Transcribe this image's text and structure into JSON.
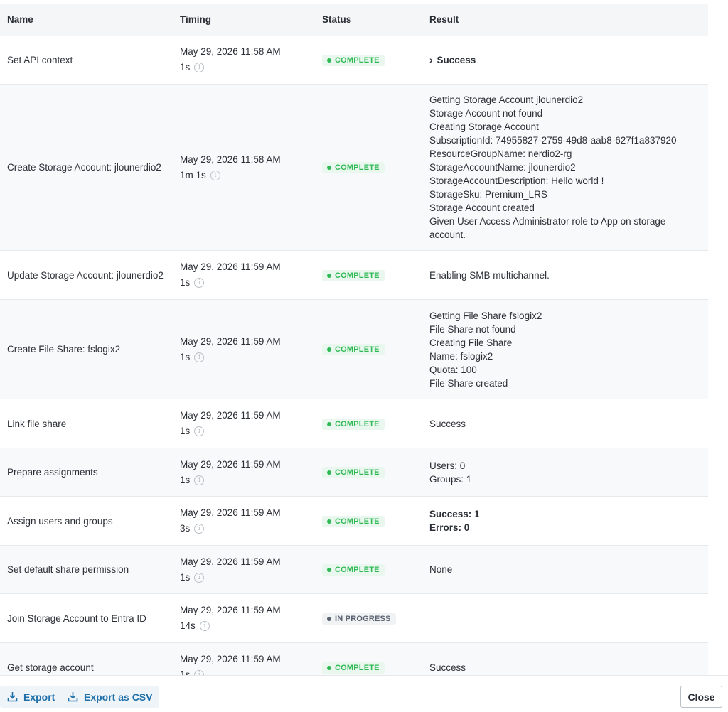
{
  "columns": {
    "name": "Name",
    "timing": "Timing",
    "status": "Status",
    "result": "Result"
  },
  "status_labels": {
    "complete": "COMPLETE",
    "in_progress": "IN PROGRESS"
  },
  "rows": [
    {
      "name": "Set API context",
      "time": "May 29, 2026 11:58 AM",
      "duration": "1s",
      "status": "COMPLETE",
      "result": [
        "Success"
      ]
    },
    {
      "name": "Create Storage Account: jlounerdio2",
      "time": "May 29, 2026 11:58 AM",
      "duration": "1m 1s",
      "status": "COMPLETE",
      "result": [
        "Getting Storage Account jlounerdio2",
        "Storage Account not found",
        "Creating Storage Account",
        "SubscriptionId: 74955827-2759-49d8-aab8-627f1a837920",
        "ResourceGroupName: nerdio2-rg",
        "StorageAccountName: jlounerdio2",
        "StorageAccountDescription: Hello world !",
        "StorageSku: Premium_LRS",
        "Storage Account created",
        "Given User Access Administrator role to App on storage",
        "account."
      ]
    },
    {
      "name": "Update Storage Account: jlounerdio2",
      "time": "May 29, 2026 11:59 AM",
      "duration": "1s",
      "status": "COMPLETE",
      "result": [
        "Enabling SMB multichannel."
      ]
    },
    {
      "name": "Create File Share: fslogix2",
      "time": "May 29, 2026 11:59 AM",
      "duration": "1s",
      "status": "COMPLETE",
      "result": [
        "Getting File Share fslogix2",
        "File Share not found",
        "Creating File Share",
        "Name: fslogix2",
        "Quota: 100",
        "File Share created"
      ]
    },
    {
      "name": "Link file share",
      "time": "May 29, 2026 11:59 AM",
      "duration": "1s",
      "status": "COMPLETE",
      "result": [
        "Success"
      ]
    },
    {
      "name": "Prepare assignments",
      "time": "May 29, 2026 11:59 AM",
      "duration": "1s",
      "status": "COMPLETE",
      "result": [
        "Users: 0",
        "Groups: 1"
      ]
    },
    {
      "name": "Assign users and groups",
      "time": "May 29, 2026 11:59 AM",
      "duration": "3s",
      "status": "COMPLETE",
      "result": [
        "Success: 1",
        "Errors: 0"
      ]
    },
    {
      "name": "Set default share permission",
      "time": "May 29, 2026 11:59 AM",
      "duration": "1s",
      "status": "COMPLETE",
      "result": [
        "None"
      ]
    },
    {
      "name": "Join Storage Account to Entra ID",
      "time": "May 29, 2026 11:59 AM",
      "duration": "14s",
      "status": "IN PROGRESS",
      "result": []
    },
    {
      "name": "Get storage account",
      "time": "May 29, 2026 11:59 AM",
      "duration": "1s",
      "status": "COMPLETE",
      "result": [
        "Success"
      ]
    }
  ],
  "footer": {
    "export": "Export",
    "export_csv": "Export as CSV",
    "close": "Close"
  },
  "colors": {
    "complete": "#2fb955",
    "in_progress": "#5a6370",
    "link": "#1f6fa8"
  }
}
